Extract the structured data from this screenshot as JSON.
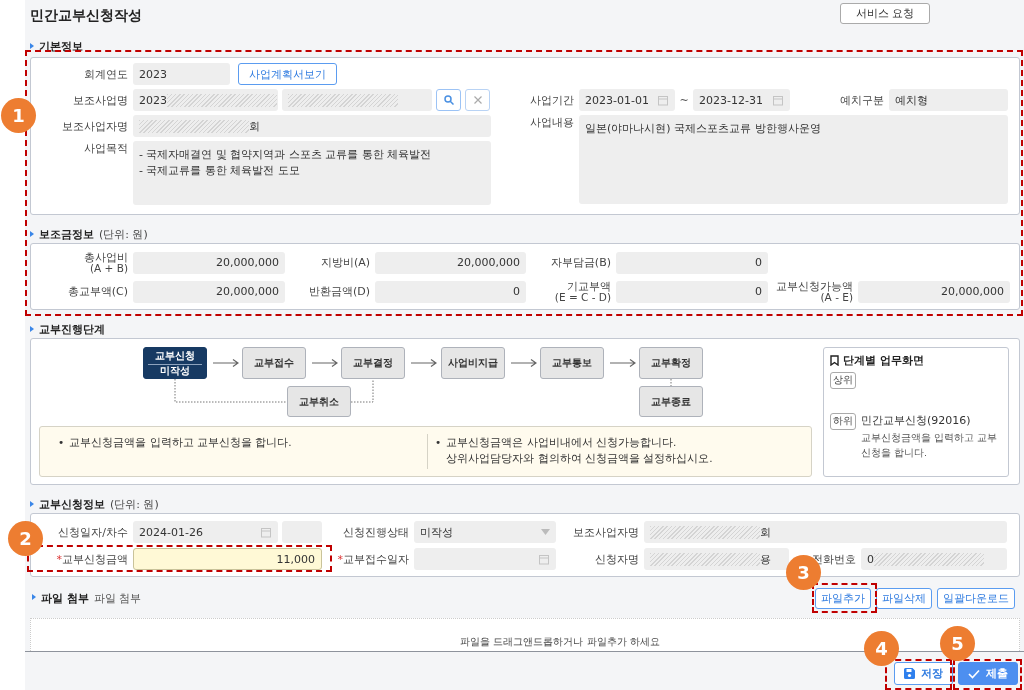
{
  "title": "민간교부신청작성",
  "service_button": "서비스 요청",
  "basic_info": {
    "heading": "기본정보",
    "fiscal_year": {
      "label": "회계연도",
      "value": "2023"
    },
    "plan_button": "사업계획서보기",
    "project_name": {
      "label": "보조사업명",
      "value": "2023",
      "masked_after": true
    },
    "project_name_detail": {
      "masked_after": true
    },
    "operator_name": {
      "label": "보조사업자명",
      "value": "회",
      "masked_before": true
    },
    "purpose": {
      "label": "사업목적",
      "lines": [
        "- 국제자매결연 및 협약지역과 스포츠 교류를 통한 체육발전",
        "- 국제교류를 통한 체육발전 도모"
      ]
    },
    "period": {
      "label": "사업기간",
      "start": "2023-01-01",
      "separator": "~",
      "end": "2023-12-31"
    },
    "deposit_type": {
      "label": "예치구분",
      "value": "예치형"
    },
    "content": {
      "label": "사업내용",
      "value": "일본(야마나시현) 국제스포츠교류 방한행사운영"
    }
  },
  "subsidy": {
    "heading": "보조금정보",
    "unit": "(단위: 원)",
    "rows": [
      [
        {
          "label": "총사업비",
          "sub": "(A + B)",
          "value": "20,000,000"
        },
        {
          "label": "지방비(A)",
          "value": "20,000,000"
        },
        {
          "label": "자부담금(B)",
          "value": "0"
        }
      ],
      [
        {
          "label": "총교부액(C)",
          "value": "20,000,000"
        },
        {
          "label": "반환금액(D)",
          "value": "0"
        },
        {
          "label": "기교부액",
          "sub": "(E = C - D)",
          "value": "0"
        },
        {
          "label": "교부신청가능액",
          "sub": "(A - E)",
          "value": "20,000,000"
        }
      ]
    ]
  },
  "stages": {
    "heading": "교부진행단계",
    "steps": [
      {
        "label": "교부신청",
        "status": "미작성",
        "selected": true
      },
      {
        "label": "교부접수",
        "selected": false
      },
      {
        "label": "교부결정",
        "selected": false
      },
      {
        "label": "사업비지급",
        "selected": false
      },
      {
        "label": "교부통보",
        "selected": false
      },
      {
        "label": "교부확정",
        "selected": false
      }
    ],
    "branches": [
      {
        "label": "교부취소"
      },
      {
        "label": "교부종료"
      }
    ],
    "notes": [
      {
        "bullet": "•",
        "lines": [
          "교부신청금액을 입력하고 교부신청을 합니다."
        ]
      },
      {
        "bullet": "•",
        "lines": [
          "교부신청금액은 사업비내에서 신청가능합니다.",
          "상위사업담당자와 협의하여 신청금액을 설정하십시오."
        ]
      }
    ],
    "screens": {
      "title": "단계별 업무화면",
      "upper": {
        "tag": "상위"
      },
      "lower": {
        "tag": "하위",
        "name": "민간교부신청(92016)",
        "desc": "교부신청금액을 입력하고 교부신청을 합니다."
      }
    }
  },
  "application": {
    "heading": "교부신청정보",
    "unit": "(단위: 원)",
    "date": {
      "label": "신청일자/차수",
      "value": "2024-01-26"
    },
    "status": {
      "label": "신청진행상태",
      "value": "미작성"
    },
    "operator": {
      "label": "보조사업자명",
      "value": "회",
      "masked_before": true
    },
    "amount": {
      "label": "교부신청금액",
      "required_mark": "*",
      "value": "11,000"
    },
    "receipt_date": {
      "label": "교부접수일자",
      "required_mark": "*"
    },
    "applicant": {
      "label": "신청자명",
      "value": "용",
      "masked_before": true
    },
    "phone": {
      "label": "전화번호",
      "value": "0",
      "masked_after": true
    }
  },
  "files": {
    "heading": "파일 첨부",
    "subheading": "파일 첨부",
    "buttons": [
      "파일추가",
      "파일삭제",
      "일괄다운로드"
    ],
    "drop_hint": "파일을 드래그앤드롭하거나 파일추가 하세요"
  },
  "footer": {
    "buttons": [
      {
        "label": "저장",
        "kind": "save"
      },
      {
        "label": "제출",
        "kind": "submit"
      }
    ]
  },
  "annotations": [
    {
      "number": "1"
    },
    {
      "number": "2"
    },
    {
      "number": "3"
    },
    {
      "number": "4"
    },
    {
      "number": "5"
    }
  ]
}
